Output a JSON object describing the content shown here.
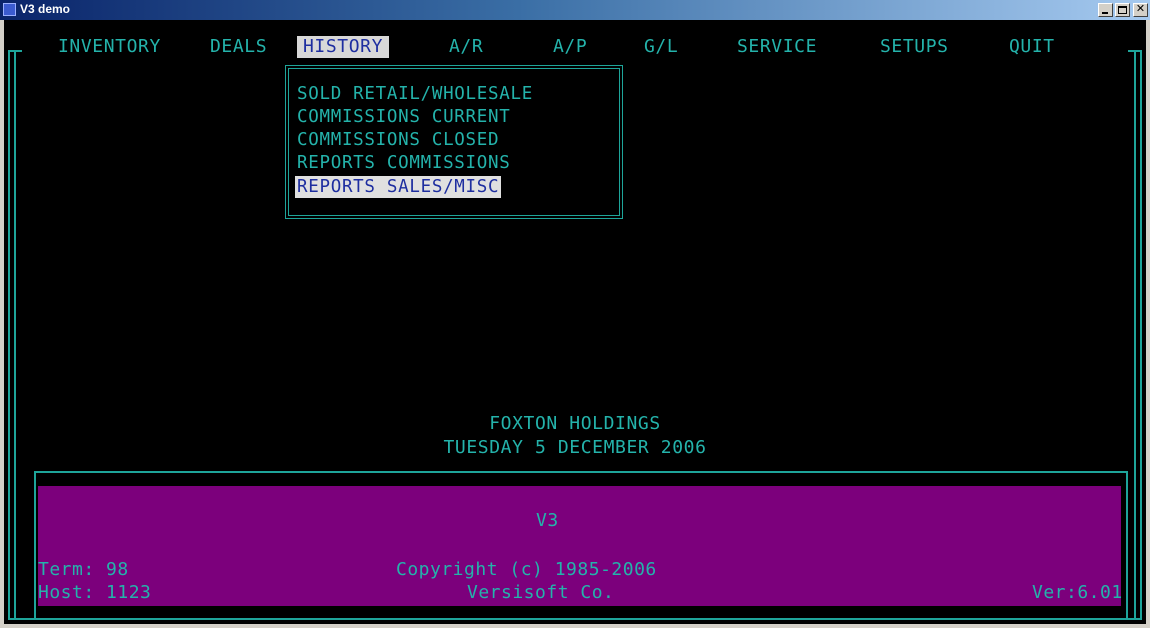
{
  "window": {
    "title": "V3 demo",
    "icons": [
      "app-icon",
      "minimize-icon",
      "maximize-icon",
      "close-icon"
    ]
  },
  "menu": {
    "items": [
      "INVENTORY",
      "DEALS",
      "HISTORY",
      "A/R",
      "A/P",
      "G/L",
      "SERVICE",
      "SETUPS",
      "QUIT"
    ],
    "selected": "HISTORY"
  },
  "submenu": {
    "items": [
      "SOLD RETAIL/WHOLESALE",
      "COMMISSIONS CURRENT",
      "COMMISSIONS CLOSED",
      "REPORTS COMMISSIONS",
      "REPORTS SALES/MISC"
    ],
    "selected": "REPORTS SALES/MISC"
  },
  "center": {
    "company": "FOXTON HOLDINGS",
    "date": "TUESDAY 5 DECEMBER 2006"
  },
  "footer": {
    "app_name": "V3",
    "term": "Term: 98",
    "host": "Host: 1123",
    "copyright": "Copyright (c) 1985-2006",
    "company": "Versisoft Co.",
    "version": "Ver:6.01"
  },
  "colors": {
    "text": "#24b3ab",
    "border": "#1ea59a",
    "background": "#000000",
    "footer_panel": "#7c007c",
    "highlight_bg": "#d8d8d8",
    "highlight_text": "#1e2ea0"
  }
}
